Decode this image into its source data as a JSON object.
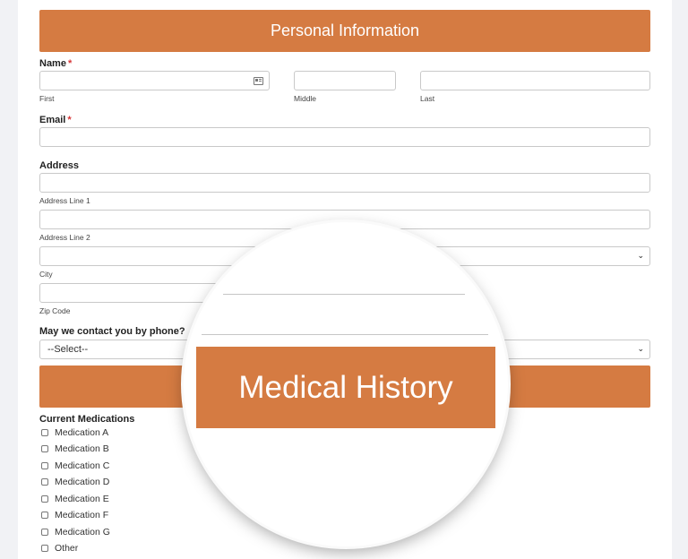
{
  "personal_section": {
    "title": "Personal Information"
  },
  "name_field": {
    "label": "Name",
    "required_mark": "*",
    "sublabels": {
      "first": "First",
      "middle": "Middle",
      "last": "Last"
    },
    "icon": "contact-card-icon"
  },
  "email_field": {
    "label": "Email",
    "required_mark": "*"
  },
  "address_field": {
    "label": "Address",
    "sublabels": {
      "line1": "Address Line 1",
      "line2": "Address Line 2",
      "city": "City",
      "zip": "Zip Code"
    },
    "state_icon": "chevron-down-icon"
  },
  "contact_field": {
    "label": "May we contact you by phone?",
    "selected": "--Select--",
    "icon": "chevron-down-icon"
  },
  "medical_section": {
    "title": "Medical History"
  },
  "medications": {
    "label": "Current Medications",
    "options": [
      "Medication A",
      "Medication B",
      "Medication C",
      "Medication D",
      "Medication E",
      "Medication F",
      "Medication G",
      "Other"
    ]
  },
  "colors": {
    "accent": "#d57b42",
    "page_bg": "#f1f2f5",
    "required": "#d63638"
  }
}
